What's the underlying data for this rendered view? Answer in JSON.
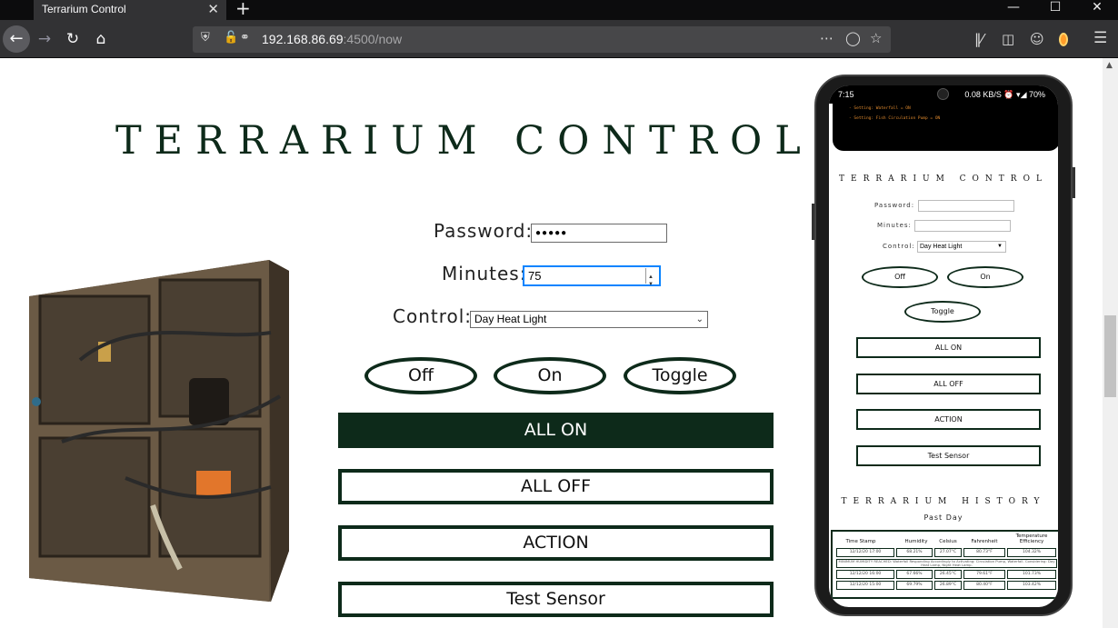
{
  "browser": {
    "tab_title": "Terrarium Control",
    "tab_close": "✕",
    "new_tab": "+",
    "url_host": "192.168.86.69",
    "url_rest": ":4500/now",
    "window_controls": [
      "—",
      "☐",
      "✕"
    ]
  },
  "page": {
    "title": "TERRARIUM CONTROL",
    "password_label": "Password:",
    "password_value": "●●●●●",
    "minutes_label": "Minutes:",
    "minutes_value": "75",
    "control_label": "Control:",
    "control_value": "Day Heat Light",
    "buttons": {
      "off": "Off",
      "on": "On",
      "toggle": "Toggle",
      "all_on": "ALL ON",
      "all_off": "ALL OFF",
      "action": "ACTION",
      "test_sensor": "Test Sensor"
    },
    "colors": {
      "accent": "#0d2a1a"
    }
  },
  "phone": {
    "status_time": "7:15",
    "status_right": "0.08 KB/S ⏰ ▾◢ 70%",
    "log_lines": [
      "- Setting: Waterfall = ON",
      "- Setting: Fish Circulation Pump = ON"
    ],
    "title": "TERRARIUM CONTROL",
    "password_label": "Password:",
    "minutes_label": "Minutes:",
    "control_label": "Control:",
    "control_value": "Day Heat Light",
    "buttons": {
      "off": "Off",
      "on": "On",
      "toggle": "Toggle",
      "all_on": "ALL ON",
      "all_off": "ALL OFF",
      "action": "ACTION",
      "test_sensor": "Test Sensor"
    },
    "history_title": "TERRARIUM HISTORY",
    "history_subtitle": "Past Day",
    "history_headers": [
      "Time Stamp",
      "Humidity",
      "Celsius",
      "Fahrenheit",
      "Temperature Efficiency"
    ],
    "history_rows": [
      [
        "12/12/20 17:00",
        "68.21%",
        "27.07°C",
        "80.73°F",
        "104.32%"
      ],
      [
        "12/12/20 16:00",
        "67.66%",
        "26.45°C",
        "79.61°F",
        "101.73%"
      ],
      [
        "12/12/20 15:00",
        "69.79%",
        "26.89°C",
        "80.40°F",
        "103.42%"
      ]
    ],
    "history_note": "MINIMUM HUMIDITY REACHED: Waterfall Responding Accordingly to Activating: Circulation Pump, Waterfall. Considering: Day Heat Lamp, Night Heat Lamp."
  }
}
